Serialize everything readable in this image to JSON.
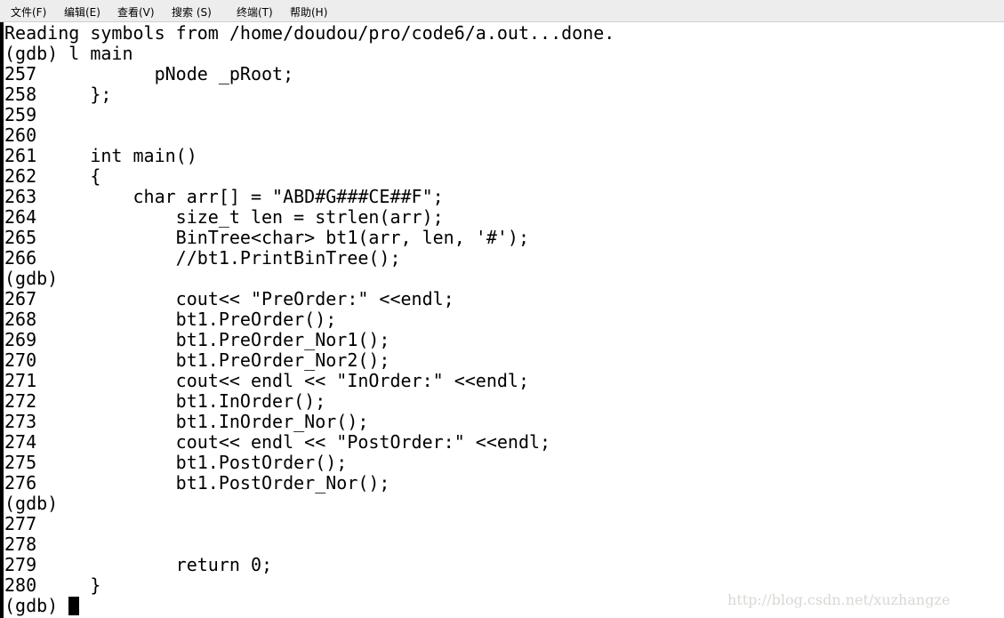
{
  "menubar": {
    "items": [
      "文件(F)",
      "编辑(E)",
      "查看(V)",
      "搜索 (S)",
      "终端(T)",
      "帮助(H)"
    ]
  },
  "terminal": {
    "lines": [
      "Reading symbols from /home/doudou/pro/code6/a.out...done.",
      "(gdb) l main",
      "257           pNode _pRoot;",
      "258     };",
      "259",
      "260",
      "261     int main()",
      "262     {",
      "263         char arr[] = \"ABD#G###CE##F\";",
      "264             size_t len = strlen(arr);",
      "265             BinTree<char> bt1(arr, len, '#');",
      "266             //bt1.PrintBinTree();",
      "(gdb)",
      "267             cout<< \"PreOrder:\" <<endl;",
      "268             bt1.PreOrder();",
      "269             bt1.PreOrder_Nor1();",
      "270             bt1.PreOrder_Nor2();",
      "271             cout<< endl << \"InOrder:\" <<endl;",
      "272             bt1.InOrder();",
      "273             bt1.InOrder_Nor();",
      "274             cout<< endl << \"PostOrder:\" <<endl;",
      "275             bt1.PostOrder();",
      "276             bt1.PostOrder_Nor();",
      "(gdb)",
      "277",
      "278",
      "279             return 0;",
      "280     }"
    ],
    "prompt": "(gdb) "
  },
  "watermark": "http://blog.csdn.net/xuzhangze"
}
